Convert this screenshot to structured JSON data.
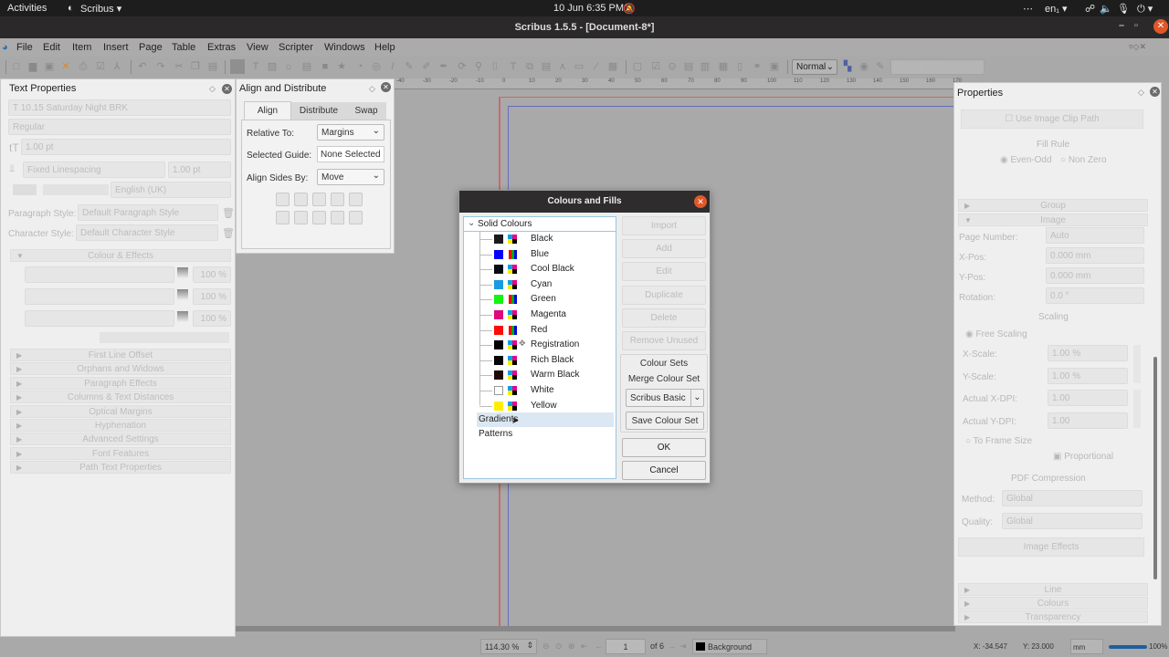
{
  "system_bar": {
    "activities": "Activities",
    "app_menu": "Scribus ▾",
    "datetime": "10 Jun   6:35 PM",
    "lang": "en₁ ▾",
    "tray": "⋯",
    "power": "⏻ ▾"
  },
  "window": {
    "title": "Scribus 1.5.5 - [Document-8*]",
    "minimize": "–",
    "restore": "▫",
    "close": "✕"
  },
  "menubar": [
    "File",
    "Edit",
    "Item",
    "Insert",
    "Page",
    "Table",
    "Extras",
    "View",
    "Scripter",
    "Windows",
    "Help"
  ],
  "toolbar": {
    "mode_select": "Normal",
    "vision_select": "Normal Vision"
  },
  "ruler": {
    "ticks": [
      "-40",
      "-30",
      "-20",
      "-10",
      "0",
      "10",
      "20",
      "30",
      "40",
      "50",
      "60",
      "70",
      "80",
      "90",
      "100",
      "110",
      "120",
      "130",
      "140",
      "150",
      "160",
      "170"
    ]
  },
  "text_properties": {
    "title": "Text Properties",
    "font": "10.15 Saturday Night BRK",
    "style": "Regular",
    "size": "1.00 pt",
    "linespacing_mode": "Fixed Linespacing",
    "linespacing": "1.00 pt",
    "language": "English (UK)",
    "paragraph_style_label": "Paragraph Style:",
    "paragraph_style": "Default Paragraph Style",
    "character_style_label": "Character Style:",
    "character_style": "Default Character Style",
    "colour_effects": "Colour & Effects",
    "opacity": [
      "100 %",
      "100 %",
      "100 %"
    ],
    "sections": [
      "First Line Offset",
      "Orphans and Widows",
      "Paragraph Effects",
      "Columns & Text Distances",
      "Optical Margins",
      "Hyphenation",
      "Advanced Settings",
      "Font Features",
      "Path Text Properties"
    ]
  },
  "align_distribute": {
    "title": "Align and Distribute",
    "tabs": [
      "Align",
      "Distribute",
      "Swap"
    ],
    "active_tab": "Align",
    "relative_to_label": "Relative To:",
    "relative_to": "Margins",
    "selected_guide_label": "Selected Guide:",
    "selected_guide": "None Selected",
    "align_sides_label": "Align Sides By:",
    "align_sides": "Move"
  },
  "colours_dialog": {
    "title": "Colours and Fills",
    "root_solid": "Solid Colours",
    "colours": [
      {
        "name": "Black",
        "swatch": "#1a1a1a",
        "model": "cmyk"
      },
      {
        "name": "Blue",
        "swatch": "#0000ff",
        "model": "rgb"
      },
      {
        "name": "Cool Black",
        "swatch": "#060a14",
        "model": "cmyk"
      },
      {
        "name": "Cyan",
        "swatch": "#1a9ae0",
        "model": "cmyk"
      },
      {
        "name": "Green",
        "swatch": "#11f511",
        "model": "rgb"
      },
      {
        "name": "Magenta",
        "swatch": "#dd0a7e",
        "model": "cmyk"
      },
      {
        "name": "Red",
        "swatch": "#ff0a0a",
        "model": "rgb"
      },
      {
        "name": "Registration",
        "swatch": "#000000",
        "model": "cmyk-reg"
      },
      {
        "name": "Rich Black",
        "swatch": "#050505",
        "model": "cmyk"
      },
      {
        "name": "Warm Black",
        "swatch": "#210808",
        "model": "cmyk"
      },
      {
        "name": "White",
        "swatch": "#ffffff",
        "model": "cmyk"
      },
      {
        "name": "Yellow",
        "swatch": "#ffee00",
        "model": "cmyk"
      }
    ],
    "gradients": "Gradients",
    "patterns": "Patterns",
    "buttons": {
      "import": "Import",
      "add": "Add",
      "edit": "Edit",
      "duplicate": "Duplicate",
      "delete": "Delete",
      "remove_unused": "Remove Unused",
      "save_colour_set": "Save Colour Set",
      "ok": "OK",
      "cancel": "Cancel"
    },
    "colour_sets_title": "Colour Sets",
    "merge_label": "Merge Colour Set",
    "set_select": "Scribus Basic"
  },
  "properties": {
    "title": "Properties",
    "clip_path": "Use Image Clip Path",
    "fill_rule": "Fill Rule",
    "fill_even_odd": "Even-Odd",
    "fill_non_zero": "Non Zero",
    "group": "Group",
    "image": "Image",
    "page_number_label": "Page Number:",
    "page_number": "Auto",
    "xpos_label": "X-Pos:",
    "xpos": "0.000 mm",
    "ypos_label": "Y-Pos:",
    "ypos": "0.000 mm",
    "rotation_label": "Rotation:",
    "rotation": "0.0 °",
    "scaling": "Scaling",
    "free_scaling": "Free Scaling",
    "xscale_label": "X-Scale:",
    "xscale": "1.00 %",
    "yscale_label": "Y-Scale:",
    "yscale": "1.00 %",
    "xdpi_label": "Actual X-DPI:",
    "xdpi": "1.00",
    "ydpi_label": "Actual Y-DPI:",
    "ydpi": "1.00",
    "to_frame": "To Frame Size",
    "proportional": "Proportional",
    "pdf_compression": "PDF Compression",
    "method_label": "Method:",
    "method": "Global",
    "quality_label": "Quality:",
    "quality": "Global",
    "image_effects": "Image Effects",
    "line": "Line",
    "colours": "Colours",
    "transparency": "Transparency"
  },
  "statusbar": {
    "zoom": "114.30 %",
    "page": "1",
    "of_pages": "of 6",
    "layer": "Background",
    "x": "X: -34.547",
    "y": "Y: 23.000",
    "unit": "mm",
    "progress": "100%"
  }
}
